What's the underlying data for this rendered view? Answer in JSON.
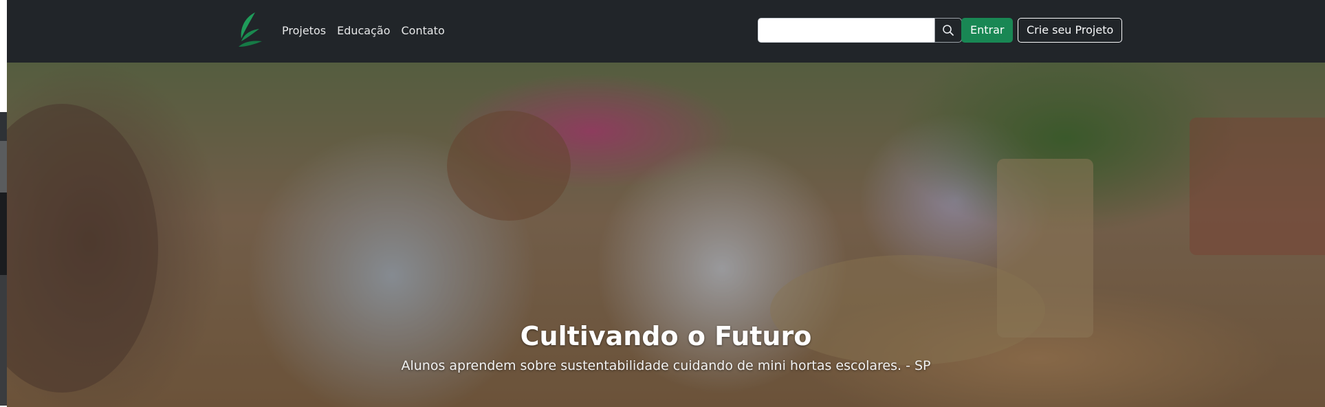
{
  "navbar": {
    "links": [
      "Projetos",
      "Educação",
      "Contato"
    ],
    "search": {
      "placeholder": "",
      "value": ""
    },
    "login_label": "Entrar",
    "create_project_label": "Crie seu Projeto"
  },
  "icons": {
    "logo": "leaf-logo-icon",
    "search": "search-icon"
  },
  "colors": {
    "navbar_bg": "#212529",
    "accent_green": "#198754",
    "logo_green": "#1f9b5a"
  },
  "hero": {
    "title": "Cultivando o Futuro",
    "caption": "Alunos aprendem sobre sustentabilidade cuidando de mini hortas escolares. - SP"
  }
}
